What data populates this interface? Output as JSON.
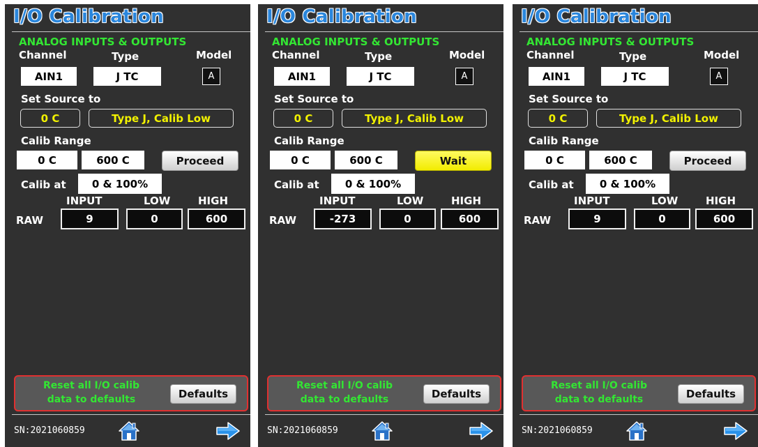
{
  "panels": [
    {
      "title": "I/O Calibration",
      "section": "ANALOG INPUTS & OUTPUTS",
      "headers": {
        "channel": "Channel",
        "type": "Type",
        "model": "Model"
      },
      "channel": "AIN1",
      "type": "J TC",
      "model": "A",
      "set_source_label": "Set Source to",
      "source_value": "0 C",
      "source_desc": "Type J, Calib Low",
      "calib_range_label": "Calib Range",
      "range_low": "0 C",
      "range_high": "600 C",
      "action_button": "Proceed",
      "action_state": "proceed",
      "calib_at_label": "Calib at",
      "calib_at_value": "0 & 100%",
      "raw_headers": {
        "input": "INPUT",
        "low": "LOW",
        "high": "HIGH"
      },
      "raw_label": "RAW",
      "raw_input": "9",
      "raw_low": "0",
      "raw_high": "600",
      "reset_text_1": "Reset all I/O calib",
      "reset_text_2": "data to defaults",
      "defaults_button": "Defaults",
      "serial": "SN:2021060859",
      "home_icon": "home-icon",
      "next_icon": "arrow-right-icon"
    },
    {
      "title": "I/O Calibration",
      "section": "ANALOG INPUTS & OUTPUTS",
      "headers": {
        "channel": "Channel",
        "type": "Type",
        "model": "Model"
      },
      "channel": "AIN1",
      "type": "J TC",
      "model": "A",
      "set_source_label": "Set Source to",
      "source_value": "0 C",
      "source_desc": "Type J, Calib Low",
      "calib_range_label": "Calib Range",
      "range_low": "0 C",
      "range_high": "600 C",
      "action_button": "Wait",
      "action_state": "wait",
      "calib_at_label": "Calib at",
      "calib_at_value": "0 & 100%",
      "raw_headers": {
        "input": "INPUT",
        "low": "LOW",
        "high": "HIGH"
      },
      "raw_label": "RAW",
      "raw_input": "-273",
      "raw_low": "0",
      "raw_high": "600",
      "reset_text_1": "Reset all I/O calib",
      "reset_text_2": "data to defaults",
      "defaults_button": "Defaults",
      "serial": "SN:2021060859",
      "home_icon": "home-icon",
      "next_icon": "arrow-right-icon"
    },
    {
      "title": "I/O Calibration",
      "section": "ANALOG INPUTS & OUTPUTS",
      "headers": {
        "channel": "Channel",
        "type": "Type",
        "model": "Model"
      },
      "channel": "AIN1",
      "type": "J TC",
      "model": "A",
      "set_source_label": "Set Source to",
      "source_value": "0 C",
      "source_desc": "Type J, Calib Low",
      "calib_range_label": "Calib Range",
      "range_low": "0 C",
      "range_high": "600 C",
      "action_button": "Proceed",
      "action_state": "proceed",
      "calib_at_label": "Calib at",
      "calib_at_value": "0 & 100%",
      "raw_headers": {
        "input": "INPUT",
        "low": "LOW",
        "high": "HIGH"
      },
      "raw_label": "RAW",
      "raw_input": "9",
      "raw_low": "0",
      "raw_high": "600",
      "reset_text_1": "Reset all I/O calib",
      "reset_text_2": "data to defaults",
      "defaults_button": "Defaults",
      "serial": "SN:2021060859",
      "home_icon": "home-icon",
      "next_icon": "arrow-right-icon"
    }
  ],
  "colors": {
    "background": "#303030",
    "title": "#2a86dc",
    "section": "#33e633",
    "source_text": "#f2f200",
    "wait_button": "#f2ec00",
    "reset_border": "#e03030"
  }
}
